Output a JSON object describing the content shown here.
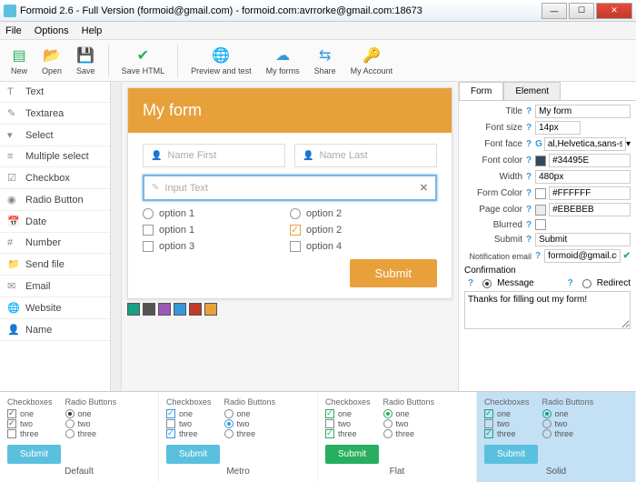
{
  "window": {
    "title": "Formoid 2.6 - Full Version (formoid@gmail.com) - formoid.com:avrrorke@gmail.com:18673"
  },
  "menu": {
    "file": "File",
    "options": "Options",
    "help": "Help"
  },
  "toolbar": {
    "new": "New",
    "open": "Open",
    "save": "Save",
    "savehtml": "Save HTML",
    "preview": "Preview and test",
    "myforms": "My forms",
    "share": "Share",
    "account": "My Account"
  },
  "sidebar": {
    "items": [
      {
        "icon": "T",
        "label": "Text"
      },
      {
        "icon": "✎",
        "label": "Textarea"
      },
      {
        "icon": "▾",
        "label": "Select"
      },
      {
        "icon": "≡",
        "label": "Multiple select"
      },
      {
        "icon": "☑",
        "label": "Checkbox"
      },
      {
        "icon": "◉",
        "label": "Radio Button"
      },
      {
        "icon": "📅",
        "label": "Date"
      },
      {
        "icon": "#",
        "label": "Number"
      },
      {
        "icon": "📁",
        "label": "Send file"
      },
      {
        "icon": "✉",
        "label": "Email"
      },
      {
        "icon": "🌐",
        "label": "Website"
      },
      {
        "icon": "👤",
        "label": "Name"
      }
    ]
  },
  "form": {
    "title": "My form",
    "name_first": "Name First",
    "name_last": "Name Last",
    "input_text": "Input Text",
    "radio1": "option 1",
    "radio2": "option 2",
    "chk1": "option 1",
    "chk2": "option 2",
    "chk3": "option 3",
    "chk4": "option 4",
    "submit": "Submit"
  },
  "palette": [
    "#16a085",
    "#555555",
    "#9b59b6",
    "#3498db",
    "#c0392b",
    "#e8a13a"
  ],
  "props": {
    "tab_form": "Form",
    "tab_element": "Element",
    "title_lbl": "Title",
    "title_val": "My form",
    "fontsize_lbl": "Font size",
    "fontsize_val": "14px",
    "fontface_lbl": "Font face",
    "fontface_val": "al,Helvetica,sans-serif",
    "fontcolor_lbl": "Font color",
    "fontcolor_val": "#34495E",
    "width_lbl": "Width",
    "width_val": "480px",
    "formcolor_lbl": "Form Color",
    "formcolor_val": "#FFFFFF",
    "pagecolor_lbl": "Page color",
    "pagecolor_val": "#EBEBEB",
    "blurred_lbl": "Blurred",
    "submit_lbl": "Submit",
    "submit_val": "Submit",
    "email_lbl": "Notification email",
    "email_val": "formoid@gmail.com",
    "confirm_lbl": "Confirmation",
    "message": "Message",
    "redirect": "Redirect",
    "confirm_msg": "Thanks for filling out my form!"
  },
  "themes": {
    "checkboxes": "Checkboxes",
    "radios": "Radio Buttons",
    "opts": [
      "one",
      "two",
      "three"
    ],
    "submit": "Submit",
    "names": {
      "default": "Default",
      "metro": "Metro",
      "flat": "Flat",
      "solid": "Solid"
    }
  }
}
